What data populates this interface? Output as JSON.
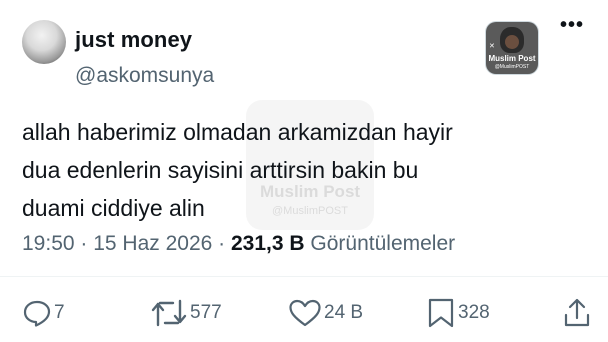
{
  "author": {
    "name": "just money",
    "handle": "@askomsunya"
  },
  "badge": {
    "brand": "Muslim Post",
    "brand_sub": "@MuslimPOST"
  },
  "watermark": {
    "title": "Muslim Post",
    "sub": "@MuslimPOST"
  },
  "tweet": {
    "lines": [
      "allah haberimiz olmadan arkamizdan hayir",
      "dua edenlerin sayisini arttirsin bakin bu",
      "duami ciddiye alin"
    ],
    "time": "19:50",
    "date": "15 Haz 2026",
    "views": "231,3 B",
    "views_label": "Görüntülemeler"
  },
  "actions": {
    "replies": "7",
    "retweets": "577",
    "likes": "24 B",
    "bookmarks": "328"
  },
  "icons": {
    "reply": "reply-icon",
    "retweet": "retweet-icon",
    "like": "heart-icon",
    "bookmark": "bookmark-icon",
    "share": "share-icon",
    "more": "more-icon"
  },
  "colors": {
    "text": "#0f1419",
    "secondary": "#536471",
    "divider": "#eff3f4"
  }
}
